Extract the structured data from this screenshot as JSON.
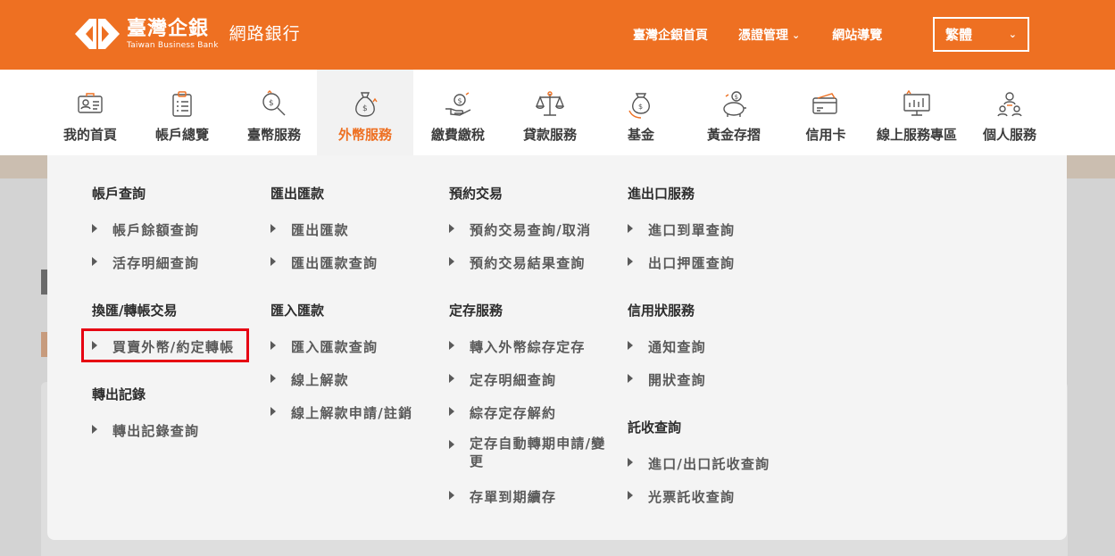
{
  "brand": {
    "name_cn": "臺灣企銀",
    "name_en": "Taiwan Business Bank",
    "subtitle": "網路銀行"
  },
  "top_links": {
    "home": "臺灣企銀首頁",
    "cert": "憑證管理",
    "sitemap": "網站導覽"
  },
  "language": {
    "selected": "繁體"
  },
  "nav": {
    "items": [
      {
        "label": "我的首頁",
        "icon": "id-card-icon"
      },
      {
        "label": "帳戶總覽",
        "icon": "clipboard-list-icon"
      },
      {
        "label": "臺幣服務",
        "icon": "search-coin-icon"
      },
      {
        "label": "外幣服務",
        "icon": "money-bag-icon"
      },
      {
        "label": "繳費繳稅",
        "icon": "hand-coin-icon"
      },
      {
        "label": "貸款服務",
        "icon": "scale-icon"
      },
      {
        "label": "基金",
        "icon": "money-cycle-icon"
      },
      {
        "label": "黃金存摺",
        "icon": "piggy-bank-icon"
      },
      {
        "label": "信用卡",
        "icon": "credit-card-icon"
      },
      {
        "label": "線上服務專區",
        "icon": "presentation-chart-icon"
      },
      {
        "label": "個人服務",
        "icon": "people-icon"
      }
    ],
    "active": "外幣服務"
  },
  "menu": {
    "col1": {
      "g1": {
        "title": "帳戶查詢",
        "items": [
          "帳戶餘額查詢",
          "活存明細查詢"
        ]
      },
      "g2": {
        "title": "換匯/轉帳交易",
        "items": [
          "買賣外幣/約定轉帳"
        ]
      },
      "g3": {
        "title": "轉出記錄",
        "items": [
          "轉出記錄查詢"
        ]
      }
    },
    "col2": {
      "g1": {
        "title": "匯出匯款",
        "items": [
          "匯出匯款",
          "匯出匯款查詢"
        ]
      },
      "g2": {
        "title": "匯入匯款",
        "items": [
          "匯入匯款查詢",
          "線上解款",
          "線上解款申請/註銷"
        ]
      }
    },
    "col3": {
      "g1": {
        "title": "預約交易",
        "items": [
          "預約交易查詢/取消",
          "預約交易結果查詢"
        ]
      },
      "g2": {
        "title": "定存服務",
        "items": [
          "轉入外幣綜存定存",
          "定存明細查詢",
          "綜存定存解約",
          "定存自動轉期申請/變更",
          "存單到期續存"
        ]
      }
    },
    "col4": {
      "g1": {
        "title": "進出口服務",
        "items": [
          "進口到單查詢",
          "出口押匯查詢"
        ]
      },
      "g2": {
        "title": "信用狀服務",
        "items": [
          "通知查詢",
          "開狀查詢"
        ]
      },
      "g3": {
        "title": "託收查詢",
        "items": [
          "進口/出口託收查詢",
          "光票託收查詢"
        ]
      }
    }
  },
  "colors": {
    "brand_orange": "#ee7022",
    "highlight_red": "#e60012"
  }
}
